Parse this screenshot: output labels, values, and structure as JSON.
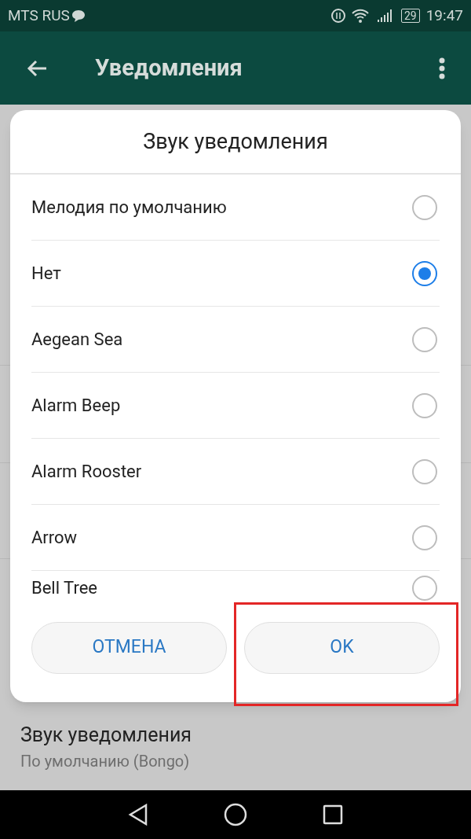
{
  "status_bar": {
    "carrier": "MTS RUS",
    "battery": "29",
    "time": "19:47"
  },
  "app_bar": {
    "title": "Уведомления"
  },
  "dialog": {
    "title": "Звук уведомления",
    "options": [
      {
        "label": "Мелодия по умолчанию",
        "selected": false
      },
      {
        "label": "Нет",
        "selected": true
      },
      {
        "label": "Aegean Sea",
        "selected": false
      },
      {
        "label": "Alarm Beep",
        "selected": false
      },
      {
        "label": "Alarm Rooster",
        "selected": false
      },
      {
        "label": "Arrow",
        "selected": false
      },
      {
        "label": "Bell Tree",
        "selected": false
      }
    ],
    "buttons": [
      "ОТМЕНА",
      "OK"
    ]
  },
  "setting": {
    "title": "Звук уведомления",
    "value": "По умолчанию (Bongo)"
  }
}
